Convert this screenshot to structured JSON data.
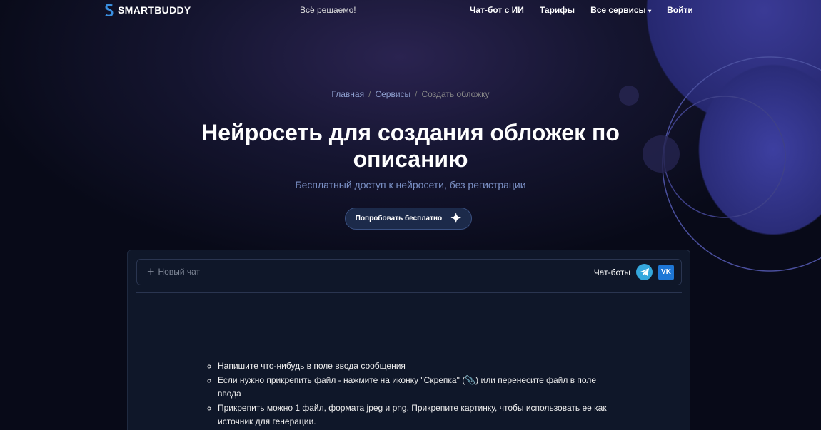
{
  "header": {
    "logo": "SMARTBUDDY",
    "slogan": "Всё решаемо!",
    "menu": [
      "Чат-бот с ИИ",
      "Тарифы",
      "Все сервисы",
      "Войти"
    ]
  },
  "breadcrumb": [
    "Главная",
    "Сервисы",
    "Создать обложку"
  ],
  "hero": {
    "title": "Нейросеть для создания обложек по описанию",
    "subtitle": "Бесплатный доступ к нейросети, без регистрации",
    "cta": "Попробовать бесплатно"
  },
  "chat": {
    "new_chat": "Новый чат",
    "bots_label": "Чат-боты",
    "vk": "VK",
    "instructions": {
      "item1": "Напишите что-нибудь в поле ввода сообщения",
      "item2_a": "Если нужно прикрепить файл - нажмите на иконку \"Скрепка\" (",
      "item2_b": ") или перенесите файл в поле ввода",
      "item3": "Прикрепить можно 1 файл, формата jpeg и png. Прикрепите картинку, чтобы использовать ее как источник для генерации."
    }
  }
}
